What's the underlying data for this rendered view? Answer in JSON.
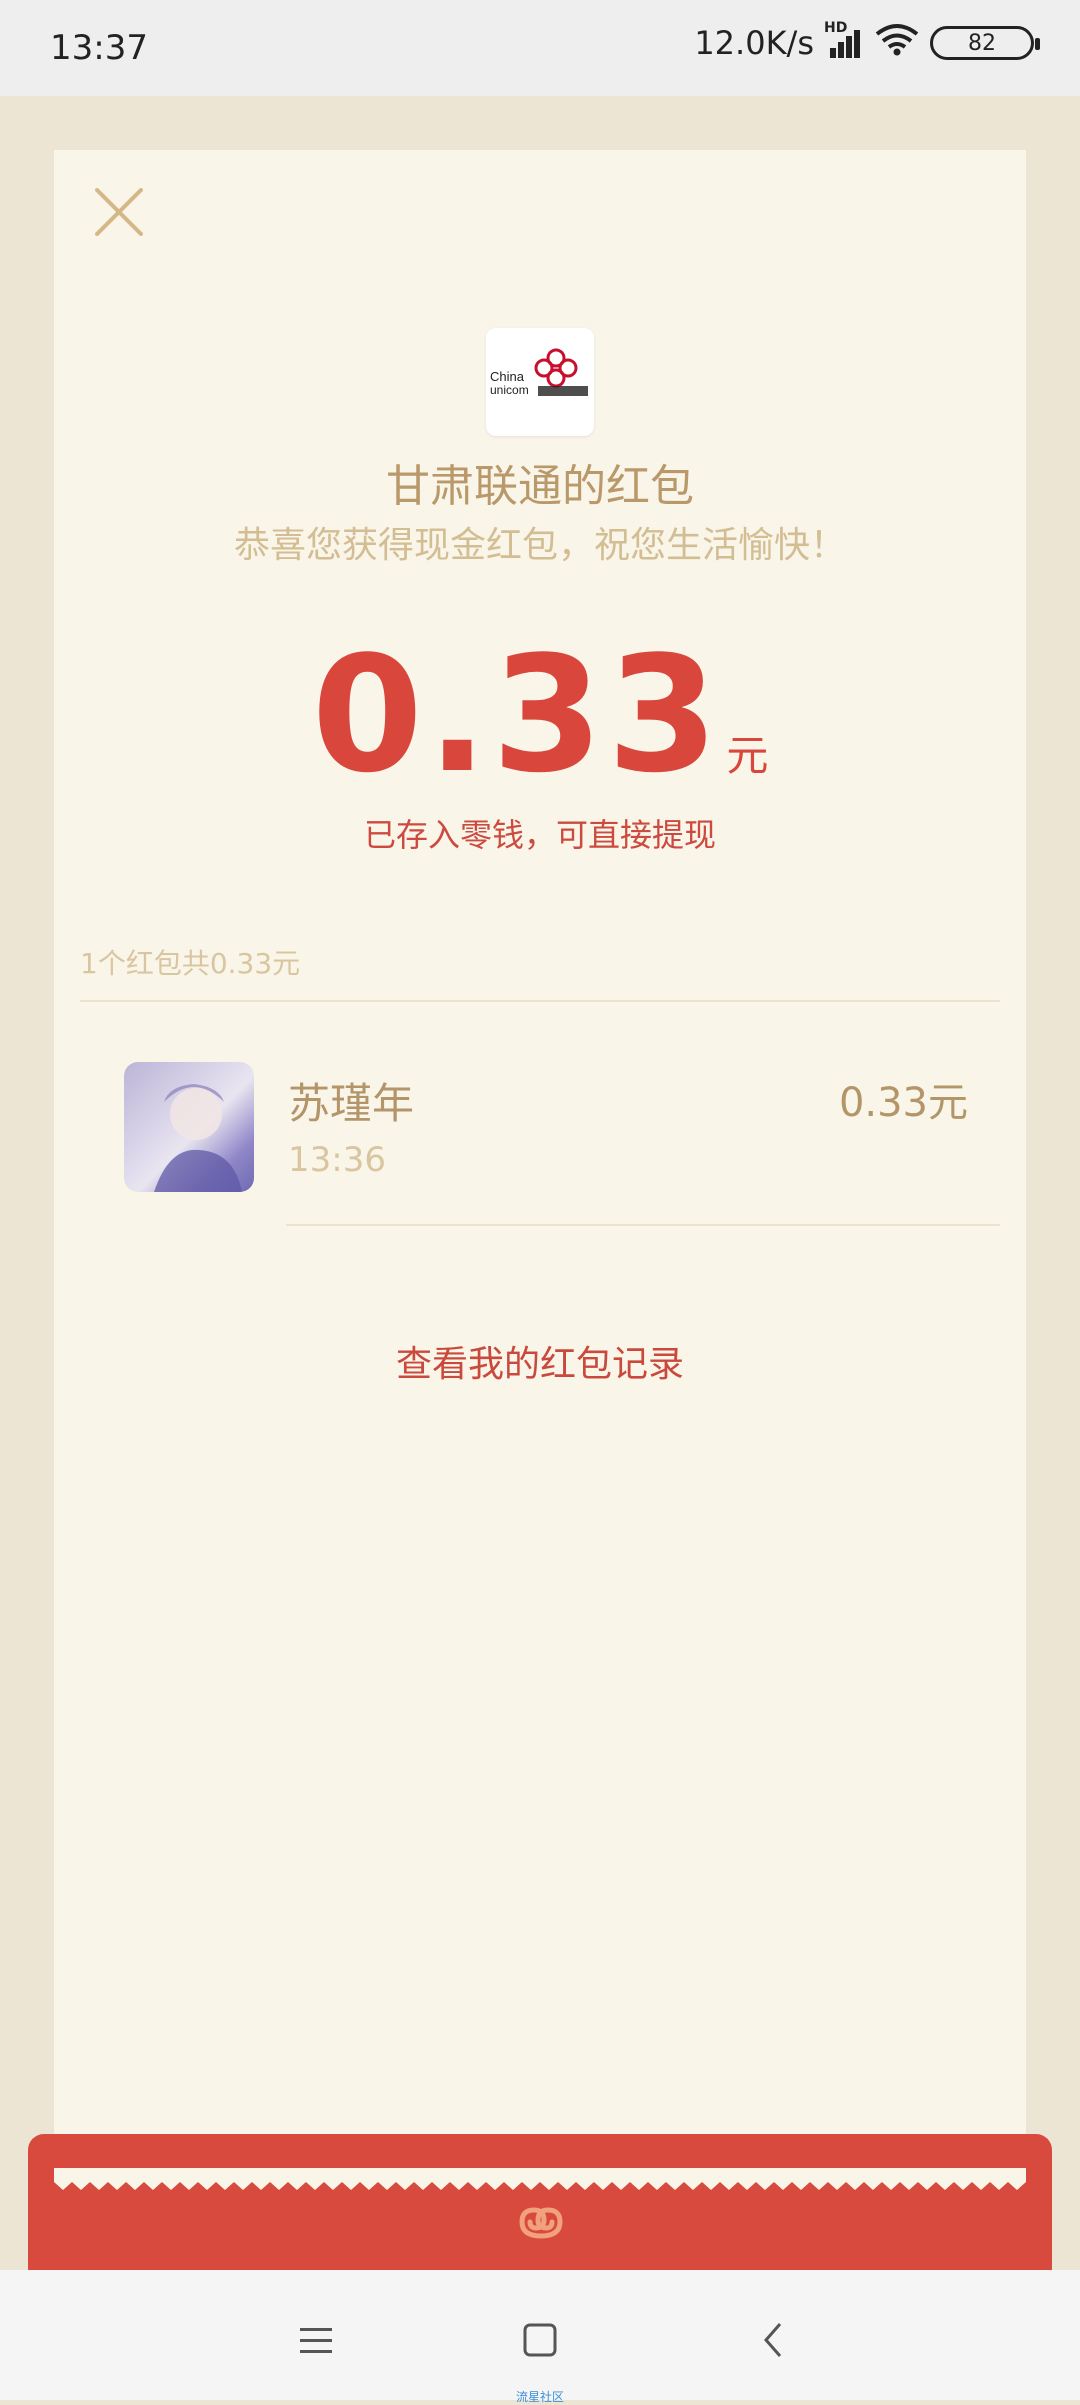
{
  "status_bar": {
    "time": "13:37",
    "network_speed": "12.0K/s",
    "network_badge": "HD",
    "battery": "82",
    "icons": [
      "signal-icon",
      "wifi-icon",
      "battery-icon"
    ]
  },
  "card": {
    "sender_title": "甘肃联通的红包",
    "wish": "恭喜您获得现金红包，祝您生活愉快！",
    "amount": "0.33",
    "amount_unit": "元",
    "deposit_note": "已存入零钱，可直接提现",
    "summary": "1个红包共0.33元",
    "recipients": [
      {
        "name": "苏瑾年",
        "time": "13:36",
        "amount": "0.33元"
      }
    ],
    "records_link": "查看我的红包记录"
  },
  "nav_bar": {
    "watermark": "流星社区"
  },
  "colors": {
    "accent_red": "#d9473c",
    "gold_text": "#b3956a",
    "card_bg": "#faf5e9",
    "page_bg": "#ede5d3"
  }
}
